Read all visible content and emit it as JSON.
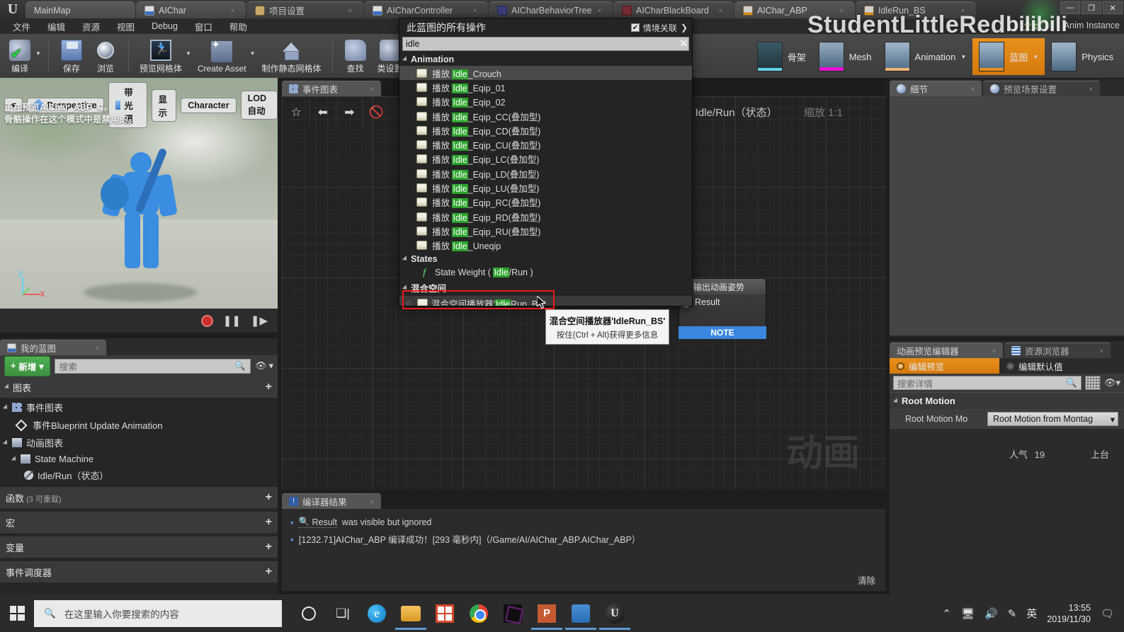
{
  "window": {
    "tabs": [
      {
        "label": "MainMap",
        "icon": "ue-logo-icon",
        "active": false,
        "closable": false
      },
      {
        "label": "AIChar",
        "icon": "blueprint-book-icon",
        "active": true,
        "closable": true
      },
      {
        "label": "项目设置",
        "icon": "project-settings-gear-icon",
        "active": false,
        "closable": true
      },
      {
        "label": "AICharController",
        "icon": "blueprint-book-icon",
        "active": false,
        "closable": true
      },
      {
        "label": "AICharBehaviorTree",
        "icon": "behavior-tree-icon",
        "active": false,
        "closable": true
      },
      {
        "label": "AICharBlackBoard",
        "icon": "blackboard-icon",
        "active": false,
        "closable": true
      },
      {
        "label": "AIChar_ABP",
        "icon": "anim-blueprint-icon",
        "active": true,
        "closable": true
      },
      {
        "label": "IdleRun_BS",
        "icon": "blendspace-icon",
        "active": false,
        "closable": true
      }
    ],
    "controls": {
      "minimize": "—",
      "maximize": "❐",
      "close": "✕"
    }
  },
  "menubar": [
    "文件",
    "编辑",
    "资源",
    "视图",
    "Debug",
    "窗口",
    "帮助"
  ],
  "toolbar": {
    "buttons": [
      {
        "label": "编译",
        "icon": "compile-icon",
        "caret": true
      },
      {
        "label": "保存",
        "icon": "save-icon",
        "caret": false
      },
      {
        "label": "浏览",
        "icon": "browse-icon",
        "caret": false
      },
      {
        "label": "预览网格体",
        "icon": "preview-mesh-icon",
        "caret": true
      },
      {
        "label": "Create Asset",
        "icon": "create-asset-icon",
        "caret": true
      },
      {
        "label": "制作静态网格体",
        "icon": "make-static-mesh-icon",
        "caret": false
      },
      {
        "label": "查找",
        "icon": "find-icon",
        "caret": false
      },
      {
        "label": "类设置",
        "icon": "class-settings-icon",
        "caret": false
      }
    ],
    "modes": [
      {
        "label": "骨架",
        "active": false,
        "caret": false
      },
      {
        "label": "Mesh",
        "active": false,
        "caret": false
      },
      {
        "label": "Animation",
        "active": false,
        "caret": true
      },
      {
        "label": "蓝图",
        "active": true,
        "caret": true
      },
      {
        "label": "Physics",
        "active": false,
        "caret": false
      }
    ],
    "parent_label": "父类",
    "anim_instance_label": "Anim Instance"
  },
  "watermark": {
    "text": "StudentLittleRed",
    "brand": "bilibili"
  },
  "viewport": {
    "buttons": [
      "Perspective",
      "带光照",
      "显示",
      "Character",
      "LOD自动"
    ],
    "overlay_lines": [
      "正在预览AIChar_ABP_C。",
      "骨骼操作在这个模式中是禁用的。"
    ],
    "axis": {
      "z": "Z",
      "x": "X"
    },
    "playback": {
      "record": "record-icon",
      "pause": "pause-icon",
      "step": "step-icon"
    }
  },
  "my_blueprint": {
    "tab": "我的蓝图",
    "add_label": "新增",
    "search_placeholder": "搜索",
    "sections": [
      {
        "label": "图表",
        "plus": "+"
      },
      {
        "label": "函数",
        "sub": "(3 可重载)",
        "plus": "+"
      },
      {
        "label": "宏",
        "plus": "+"
      },
      {
        "label": "变量",
        "plus": "+"
      },
      {
        "label": "事件调度器",
        "plus": "+"
      }
    ],
    "graph_tree": [
      {
        "label": "事件图表",
        "icon": "graph-icon",
        "indent": 0
      },
      {
        "label": "事件Blueprint Update Animation",
        "icon": "event-diamond-icon",
        "indent": 1
      },
      {
        "label": "动画图表",
        "icon": "anim-graph-icon",
        "indent": 0
      },
      {
        "label": "State Machine",
        "icon": "state-machine-icon",
        "indent": 1
      },
      {
        "label": "Idle/Run（状态）",
        "icon": "state-icon",
        "indent": 2
      }
    ]
  },
  "graph": {
    "tab": "事件图表",
    "toolbar_icons": [
      "favorite-star-icon",
      "back-arrow-icon",
      "forward-arrow-icon",
      "no-entry-icon"
    ],
    "breadcrumb": "Idle/Run（状态）",
    "zoom": "缩放 1:1",
    "watermark": "动画",
    "output_node": {
      "title": "输出动画姿势",
      "pin_label": "Result",
      "note": "NOTE"
    }
  },
  "action_menu": {
    "title": "此蓝图的所有操作",
    "context_label": "情境关联",
    "context_checked": true,
    "search_value": "idle",
    "clear_icon": "✕",
    "categories": [
      {
        "label": "Animation",
        "items": [
          {
            "prefix": "播放 ",
            "hl": "Idle",
            "suffix": "_Crouch",
            "icon": "anim-asset-icon",
            "selected": true
          },
          {
            "prefix": "播放 ",
            "hl": "Idle",
            "suffix": "_Eqip_01",
            "icon": "anim-asset-icon"
          },
          {
            "prefix": "播放 ",
            "hl": "Idle",
            "suffix": "_Eqip_02",
            "icon": "anim-asset-icon"
          },
          {
            "prefix": "播放 ",
            "hl": "Idle",
            "suffix": "_Eqip_CC(叠加型)",
            "icon": "anim-asset-icon"
          },
          {
            "prefix": "播放 ",
            "hl": "Idle",
            "suffix": "_Eqip_CD(叠加型)",
            "icon": "anim-asset-icon"
          },
          {
            "prefix": "播放 ",
            "hl": "Idle",
            "suffix": "_Eqip_CU(叠加型)",
            "icon": "anim-asset-icon"
          },
          {
            "prefix": "播放 ",
            "hl": "Idle",
            "suffix": "_Eqip_LC(叠加型)",
            "icon": "anim-asset-icon"
          },
          {
            "prefix": "播放 ",
            "hl": "Idle",
            "suffix": "_Eqip_LD(叠加型)",
            "icon": "anim-asset-icon"
          },
          {
            "prefix": "播放 ",
            "hl": "Idle",
            "suffix": "_Eqip_LU(叠加型)",
            "icon": "anim-asset-icon"
          },
          {
            "prefix": "播放 ",
            "hl": "Idle",
            "suffix": "_Eqip_RC(叠加型)",
            "icon": "anim-asset-icon"
          },
          {
            "prefix": "播放 ",
            "hl": "Idle",
            "suffix": "_Eqip_RD(叠加型)",
            "icon": "anim-asset-icon"
          },
          {
            "prefix": "播放 ",
            "hl": "Idle",
            "suffix": "_Eqip_RU(叠加型)",
            "icon": "anim-asset-icon"
          },
          {
            "prefix": "播放 ",
            "hl": "Idle",
            "suffix": "_Uneqip",
            "icon": "anim-asset-icon"
          }
        ]
      },
      {
        "label": "States",
        "items": [
          {
            "prefix": "State Weight ( ",
            "hl": "Idle",
            "suffix": "/Run )",
            "icon": "function-icon"
          }
        ]
      },
      {
        "label": "混合空间",
        "items": [
          {
            "prefix": "混合空间播放器'",
            "hl": "Idle",
            "suffix": "Run_BS'",
            "icon": "anim-asset-icon",
            "star": true,
            "highlighted": true
          }
        ]
      }
    ],
    "tooltip": {
      "title": "混合空间播放器'IdleRun_BS'",
      "hint": "按住(Ctrl + Alt)获得更多信息"
    }
  },
  "compiler": {
    "tab": "编译器结果",
    "lines": [
      {
        "link": "Result",
        "text": "was visible but ignored"
      },
      {
        "link": "",
        "text": "[1232.71]AIChar_ABP 编译成功！[293 毫秒内]（/Game/AI/AIChar_ABP.AIChar_ABP）"
      }
    ],
    "clear_label": "清除"
  },
  "right_panels": {
    "top_tabs": [
      {
        "label": "细节",
        "active": true
      },
      {
        "label": "预览场景设置",
        "active": false
      }
    ],
    "bottom_tabs": [
      {
        "label": "动画预览编辑器",
        "active": true
      },
      {
        "label": "资源浏览器",
        "active": false
      }
    ],
    "modes": [
      {
        "label": "编辑预览",
        "active": true
      },
      {
        "label": "编辑默认值",
        "active": false
      }
    ],
    "search_placeholder": "搜索详情",
    "section": "Root Motion",
    "property": {
      "label": "Root Motion Mo",
      "value": "Root Motion from Montag"
    }
  },
  "bili_overlay": {
    "popularity_label": "人气",
    "popularity_value": "19",
    "right_label": "上台"
  },
  "taskbar": {
    "search_placeholder": "在这里输入你要搜索的内容",
    "icons": [
      "cortana-circle-icon",
      "task-view-icon",
      "edge-icon",
      "file-explorer-icon",
      "microsoft-store-icon",
      "chrome-icon",
      "vs-code-icon",
      "powerpoint-icon",
      "translator-icon",
      "unreal-engine-icon"
    ],
    "tray": [
      "chevron-up-icon",
      "network-icon",
      "volume-icon",
      "pen-icon"
    ],
    "ime": "英",
    "time": "13:55",
    "date": "2019/11/30",
    "action_center": "notification-icon"
  }
}
